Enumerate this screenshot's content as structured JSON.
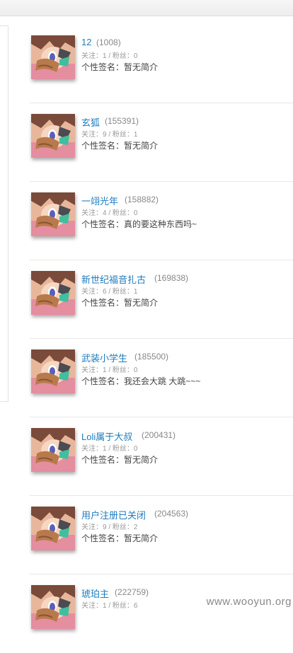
{
  "users": [
    {
      "name": "12",
      "id": "(1008)",
      "stats": "关注：1 / 粉丝：0",
      "signature": "个性签名：暂无简介"
    },
    {
      "name": "玄狐",
      "id": "(155391)",
      "stats": "关注：9 / 粉丝：1",
      "signature": "个性签名：暂无简介"
    },
    {
      "name": "一翊光年",
      "id": "(158882)",
      "stats": "关注：4 / 粉丝：0",
      "signature": "个性签名：真的要这种东西吗~"
    },
    {
      "name": "新世纪福音扎古",
      "id": "(169838)",
      "stats": "关注：6 / 粉丝：1",
      "signature": "个性签名：暂无简介"
    },
    {
      "name": "武装小学生",
      "id": "(185500)",
      "stats": "关注：1 / 粉丝：0",
      "signature": "个性签名：我还会大跳 大跳~~~"
    },
    {
      "name": "Loli属于大叔",
      "id": "(200431)",
      "stats": "关注：1 / 粉丝：0",
      "signature": "个性签名：暂无简介"
    },
    {
      "name": "用户注册已关闭",
      "id": "(204563)",
      "stats": "关注：9 / 粉丝：2",
      "signature": "个性签名：暂无简介"
    },
    {
      "name": "琥珀主",
      "id": "(222759)",
      "stats": "关注：1 / 粉丝：6",
      "signature": ""
    }
  ],
  "watermark": "www.wooyun.org"
}
